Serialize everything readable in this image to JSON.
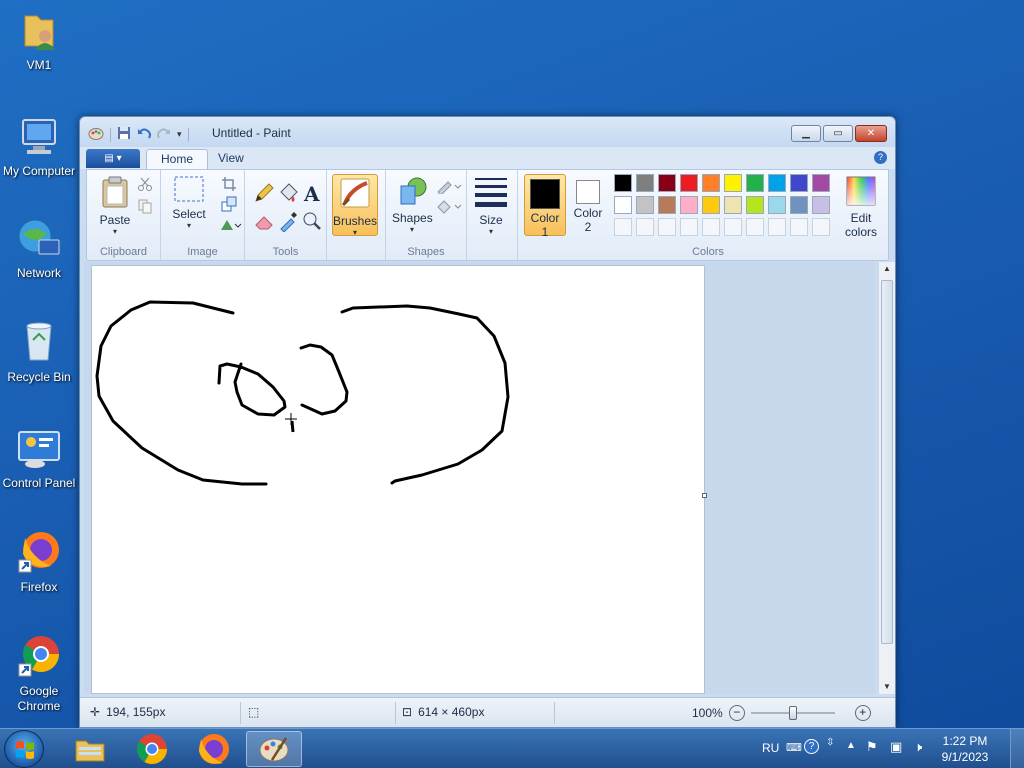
{
  "desktop": {
    "icons": [
      {
        "label": "VM1",
        "icon": "folder-user-icon"
      },
      {
        "label": "My Computer",
        "icon": "computer-icon"
      },
      {
        "label": "Network",
        "icon": "network-icon"
      },
      {
        "label": "Recycle Bin",
        "icon": "recycle-bin-icon"
      },
      {
        "label": "Control Panel",
        "icon": "control-panel-icon"
      },
      {
        "label": "Firefox",
        "icon": "firefox-icon"
      },
      {
        "label": "Google Chrome",
        "icon": "chrome-icon"
      }
    ]
  },
  "window": {
    "title": "Untitled - Paint",
    "tabs": [
      {
        "label": "Home",
        "active": true
      },
      {
        "label": "View",
        "active": false
      }
    ]
  },
  "ribbon": {
    "clipboard": {
      "group_label": "Clipboard",
      "paste_label": "Paste"
    },
    "image": {
      "group_label": "Image",
      "select_label": "Select"
    },
    "tools": {
      "group_label": "Tools"
    },
    "brushes": {
      "label": "Brushes"
    },
    "shapes": {
      "group_label": "Shapes",
      "label": "Shapes"
    },
    "size": {
      "label": "Size"
    },
    "colors": {
      "group_label": "Colors",
      "color1_label": "Color",
      "color1_num": "1",
      "color2_label": "Color",
      "color2_num": "2",
      "edit_label": "Edit",
      "edit_label2": "colors",
      "color1": "#000000",
      "color2": "#ffffff",
      "palette_row1": [
        "#000000",
        "#7f7f7f",
        "#880015",
        "#ed1c24",
        "#ff7f27",
        "#fff200",
        "#22b14c",
        "#00a2e8",
        "#3f48cc",
        "#a349a4"
      ],
      "palette_row2": [
        "#ffffff",
        "#c3c3c3",
        "#b97a57",
        "#ffaec9",
        "#ffc90e",
        "#efe4b0",
        "#b5e61d",
        "#99d9ea",
        "#7092be",
        "#c8bfe7"
      ]
    }
  },
  "status": {
    "cursor_pos": "194, 155px",
    "canvas_size": "614 × 460px",
    "zoom": "100%"
  },
  "taskbar": {
    "language": "RU",
    "time": "1:22 PM",
    "date": "9/1/2023"
  }
}
